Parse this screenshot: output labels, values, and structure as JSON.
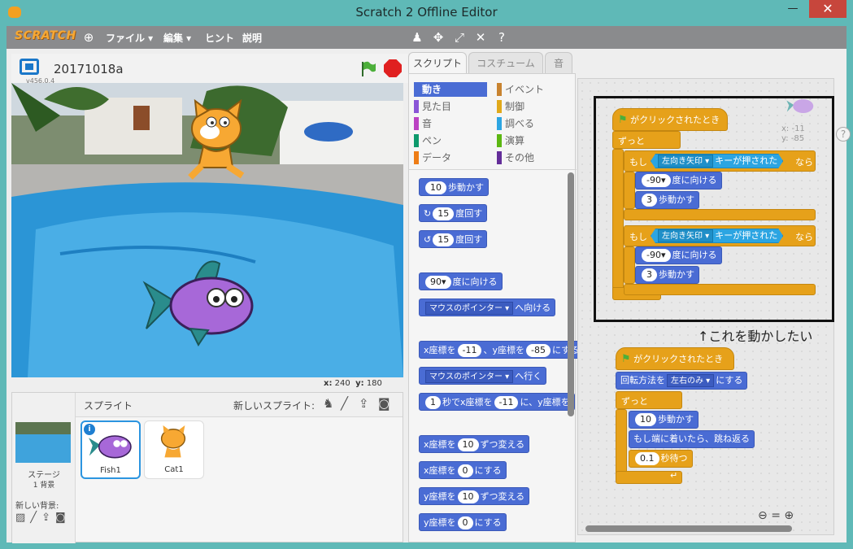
{
  "window": {
    "title": "Scratch 2 Offline Editor",
    "min": "—",
    "max": "☐",
    "close": "✕"
  },
  "menu": {
    "logo": "SCRATCH",
    "file": "ファイル ▾",
    "edit": "編集 ▾",
    "tips": "ヒント",
    "about": "説明"
  },
  "project": {
    "name": "20171018a",
    "version": "v456.0.4"
  },
  "stage": {
    "x_label": "x:",
    "x_value": "240",
    "y_label": "y:",
    "y_value": "180"
  },
  "sprites": {
    "header": "スプライト",
    "new_sprite": "新しいスプライト:",
    "stage_label": "ステージ",
    "stage_backdrops": "1 背景",
    "new_backdrop": "新しい背景:",
    "items": [
      {
        "name": "Fish1"
      },
      {
        "name": "Cat1"
      }
    ]
  },
  "tabs": {
    "scripts": "スクリプト",
    "costumes": "コスチューム",
    "sounds": "音"
  },
  "categories": {
    "motion": "動き",
    "looks": "見た目",
    "sound": "音",
    "pen": "ペン",
    "data": "データ",
    "events": "イベント",
    "control": "制御",
    "sensing": "調べる",
    "operators": "演算",
    "more": "その他",
    "colors": {
      "motion": "#4a6cd4",
      "looks": "#8a55d7",
      "sound": "#bb42c3",
      "pen": "#0e9a6c",
      "data": "#ee7d16",
      "events": "#c88330",
      "control": "#e1a91a",
      "sensing": "#2ca5e2",
      "operators": "#5cb712",
      "more": "#632d99"
    }
  },
  "palette": {
    "move": "歩動かす",
    "move_n": "10",
    "turn_r": "度回す",
    "turn_r_n": "15",
    "turn_l": "度回す",
    "turn_l_n": "15",
    "point": "度に向ける",
    "point_n": "90▾",
    "toward": "へ向ける",
    "toward_d": "マウスのポインター ▾",
    "goto_xy_a": "x座標を",
    "goto_xy_x": "-11",
    "goto_xy_b": "、y座標を",
    "goto_xy_y": "-85",
    "goto_xy_c": "にする",
    "goto": "へ行く",
    "goto_d": "マウスのポインター ▾",
    "glide_n": "1",
    "glide_a": "秒でx座標を",
    "glide_x": "-11",
    "glide_b": "に、y座標を",
    "chx_a": "x座標を",
    "chx_n": "10",
    "chx_b": "ずつ変える",
    "setx_a": "x座標を",
    "setx_n": "0",
    "setx_b": "にする",
    "chy_a": "y座標を",
    "chy_n": "10",
    "chy_b": "ずつ変える",
    "sety_a": "y座標を",
    "sety_n": "0",
    "sety_b": "にする"
  },
  "script1": {
    "hat": "がクリックされたとき",
    "forever": "ずっと",
    "if": "もし",
    "key1": "左向き矢印 ▾",
    "pressed": "キーが押された",
    "then": "なら",
    "dir1": "-90▾",
    "dir_label": "度に向ける",
    "move1": "3",
    "move_label": "歩動かす",
    "key2": "左向き矢印 ▾",
    "dir2": "-90▾",
    "move2": "3",
    "sprite_x": "x: -11",
    "sprite_y": "y: -85"
  },
  "script2": {
    "hat": "がクリックされたとき",
    "rot_a": "回転方法を",
    "rot_d": "左右のみ ▾",
    "rot_b": "にする",
    "forever": "ずっと",
    "move_n": "10",
    "move_label": "歩動かす",
    "bounce": "もし端に着いたら、跳ね返る",
    "wait_n": "0.1",
    "wait_label": "秒待つ"
  },
  "annotation": "↑これを動かしたい"
}
